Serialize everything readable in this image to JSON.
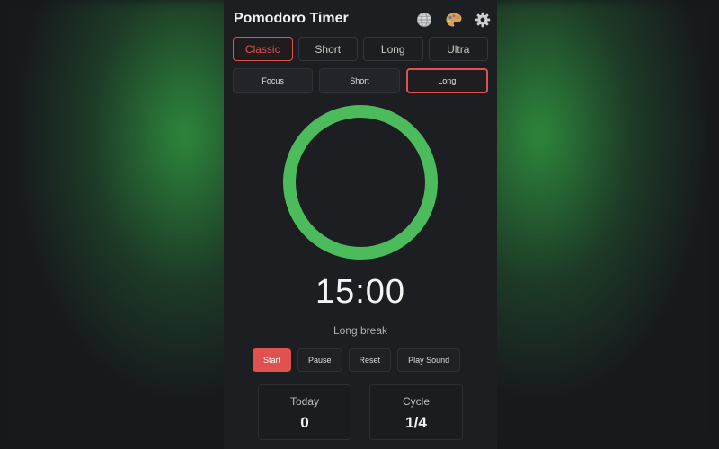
{
  "app": {
    "title": "Pomodoro Timer"
  },
  "header_icons": [
    "globe-icon",
    "palette-icon",
    "gear-icon"
  ],
  "presets": [
    {
      "label": "Classic",
      "active": true
    },
    {
      "label": "Short",
      "active": false
    },
    {
      "label": "Long",
      "active": false
    },
    {
      "label": "Ultra",
      "active": false
    }
  ],
  "modes": [
    {
      "label": "Focus",
      "active": false
    },
    {
      "label": "Short",
      "active": false
    },
    {
      "label": "Long",
      "active": true
    }
  ],
  "timer": {
    "time": "15:00",
    "mode_label": "Long break",
    "progress": 1.0,
    "ring_color": "#4cbb5c"
  },
  "controls": {
    "start": "Start",
    "pause": "Pause",
    "reset": "Reset",
    "play_sound": "Play Sound"
  },
  "stats": {
    "today_label": "Today",
    "today_value": "0",
    "cycle_label": "Cycle",
    "cycle_value": "1/4"
  },
  "colors": {
    "accent": "#e0524f",
    "ring": "#4cbb5c",
    "background": "#1c1e22"
  }
}
